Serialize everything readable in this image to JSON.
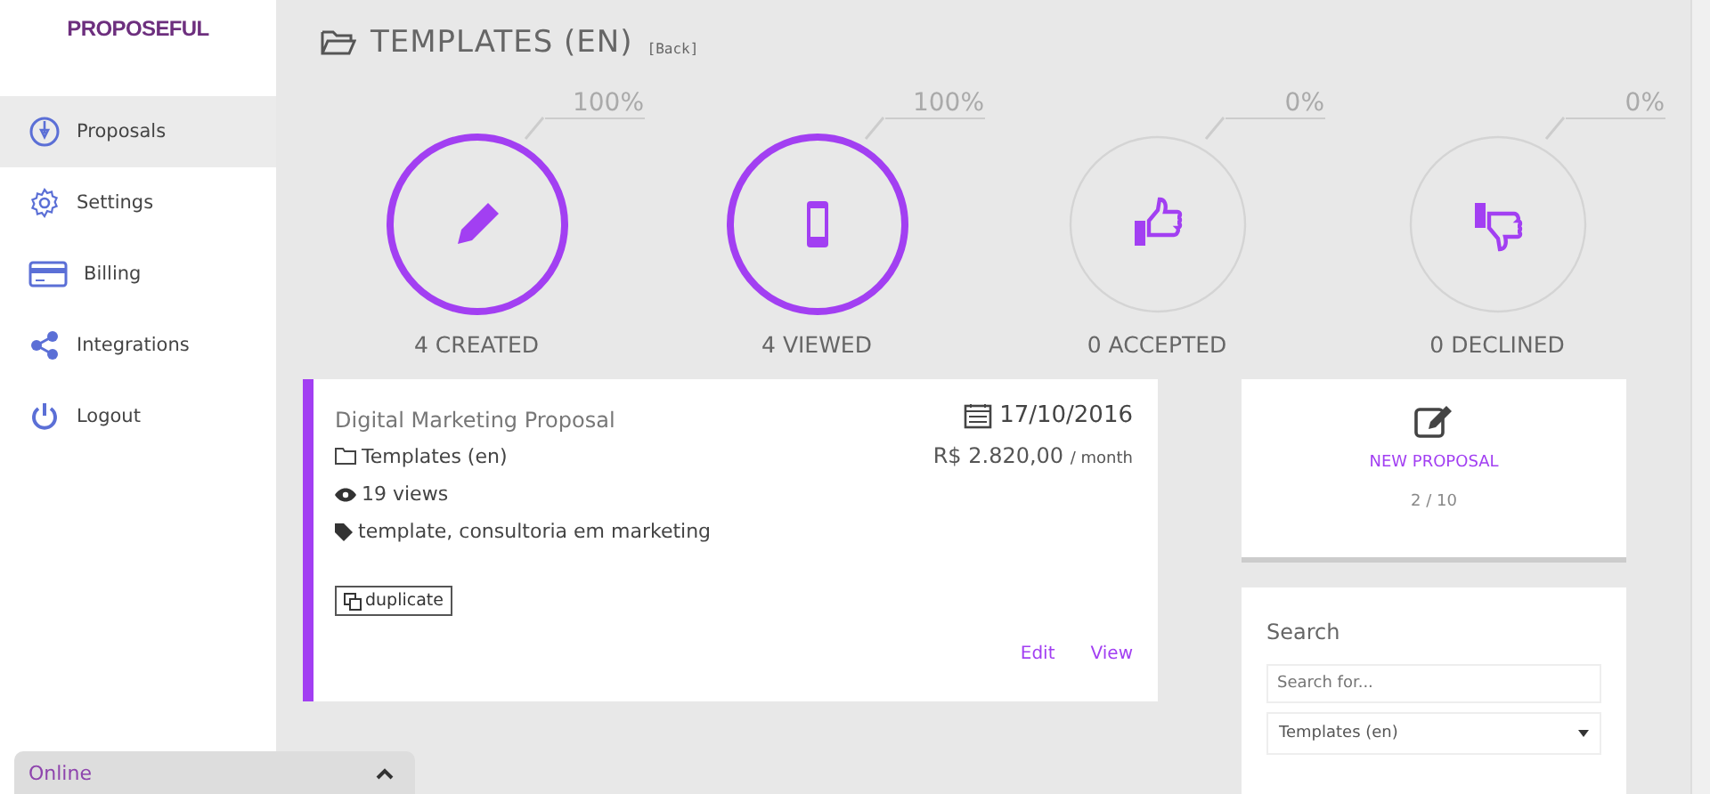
{
  "brand": {
    "logo": "PROPOSEFUL"
  },
  "sidebar": {
    "items": [
      {
        "label": "Proposals",
        "selected": true
      },
      {
        "label": "Settings",
        "selected": false
      },
      {
        "label": "Billing",
        "selected": false
      },
      {
        "label": "Integrations",
        "selected": false
      },
      {
        "label": "Logout",
        "selected": false
      }
    ]
  },
  "header": {
    "title": "TEMPLATES (EN)",
    "back_link": "[Back]"
  },
  "stats": [
    {
      "percent": "100%",
      "label": "4 CREATED",
      "highlighted": true
    },
    {
      "percent": "100%",
      "label": "4 VIEWED",
      "highlighted": true
    },
    {
      "percent": "0%",
      "label": "0 ACCEPTED",
      "highlighted": false
    },
    {
      "percent": "0%",
      "label": "0 DECLINED",
      "highlighted": false
    }
  ],
  "proposals": [
    {
      "title": "Digital Marketing Proposal",
      "date": "17/10/2016",
      "folder": "Templates (en)",
      "price": "R$ 2.820,00",
      "period": "/ month",
      "views": "19 views",
      "tags": "template, consultoria em marketing",
      "duplicate": "duplicate",
      "actions": [
        "Edit",
        "View"
      ]
    }
  ],
  "new_proposal": {
    "label": "NEW PROPOSAL",
    "count": "2 / 10"
  },
  "search": {
    "title": "Search",
    "placeholder": "Search for...",
    "folder_select": "Templates (en)"
  },
  "chat": {
    "status": "Online"
  }
}
